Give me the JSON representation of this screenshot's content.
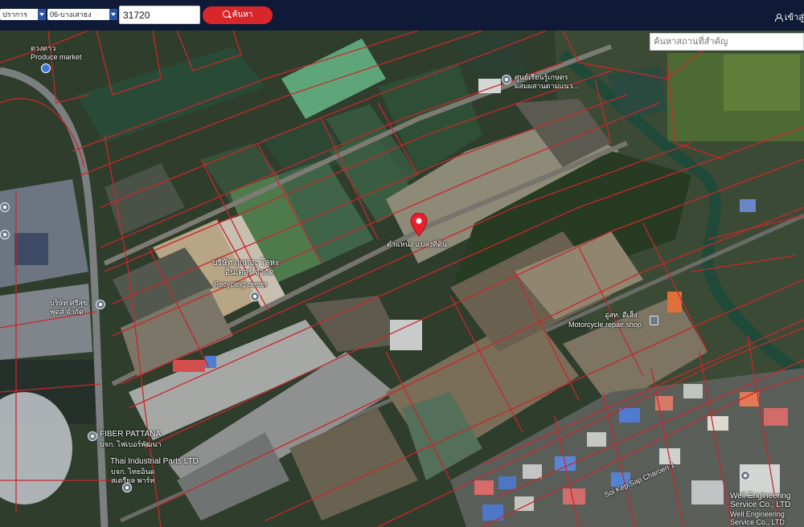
{
  "header": {
    "province_select": "ปราการ",
    "district_select": "06-บางเสาธง",
    "parcel_number": "31720",
    "search_button": "ค้นหา",
    "login_label": "เข้าสู่"
  },
  "map": {
    "place_search_placeholder": "ค้นหาสถานที่สำคัญ",
    "labels": {
      "produce_thai": "ตวงดาว",
      "produce_en": "Produce market",
      "learning_center": "ศูนย์เรียนรู้เกษตร",
      "learning_center_2": "ผสมผสานตามแนว...",
      "selected_parcel": "ตำแหน่ง แปลงที่ดิน",
      "recycling_thai_1": "บริษัท ฤกทอง โลหะ",
      "recycling_thai_2": "อินเตอร์ จำกัด",
      "recycling_en": "Recycling center",
      "company_left_1": "บริษัท ศรีสุข",
      "company_left_2": "ฟูดส์ จำกัด",
      "fiber_en": "FIBER PATTANA",
      "fiber_thai": "บจก. ไฟเบอร์พัฒนา",
      "thai_industrial_en": "Thai Industrial Parts LTD",
      "thai_industrial_thai_1": "บจก. ไทยอินด",
      "thai_industrial_thai_2": "สเตรียล พาร์ท",
      "moto_thai": "อู่สท. ดีเส็ง",
      "moto_en": "Motorcycle repair shop",
      "road": "Soi Kep Sap Charoen 1",
      "well_1": "Well Engineering",
      "well_2": "Service Co., LTD",
      "well_3": "Well Engineering",
      "well_4": "Service Co., LTD"
    }
  },
  "colors": {
    "topbar": "#0e1a36",
    "search_button": "#d9262b",
    "parcel_lines": "#c8272c",
    "marker": "#e8202a"
  },
  "icons": [
    "user-icon",
    "search-icon",
    "location-pin-icon",
    "shopping-cart-icon",
    "motorcycle-icon"
  ]
}
